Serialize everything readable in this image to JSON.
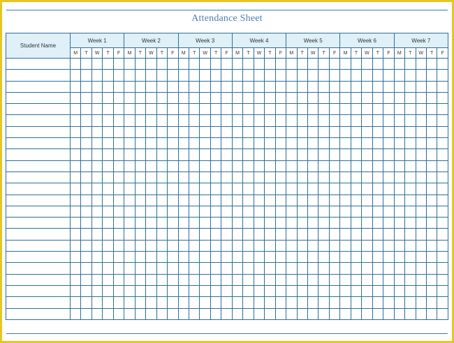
{
  "title": "Attendance Sheet",
  "student_name_header": "Student Name",
  "weeks": [
    "Week 1",
    "Week 2",
    "Week 3",
    "Week 4",
    "Week 5",
    "Week 6",
    "Week 7"
  ],
  "days": [
    "M",
    "T",
    "W",
    "T",
    "F"
  ],
  "row_count": 23,
  "colors": {
    "frame": "#e6c620",
    "grid": "#2e6e99",
    "header_fill": "#dff0f8",
    "title": "#4c7eb0"
  }
}
